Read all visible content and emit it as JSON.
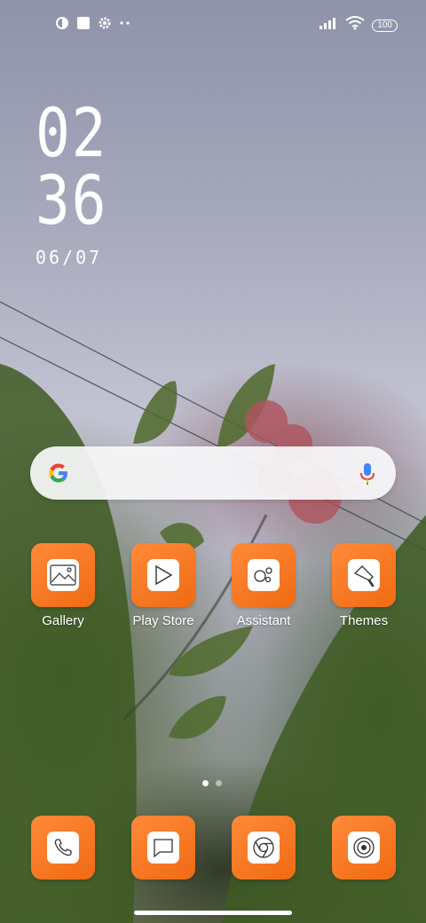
{
  "status_bar": {
    "battery_level": "100",
    "left_icons": [
      "shield-icon",
      "square-icon",
      "gear-icon",
      "more-dots-icon"
    ],
    "right_icons": [
      "signal-icon",
      "wifi-icon",
      "battery-icon"
    ]
  },
  "clock": {
    "hour": "02",
    "minute": "36",
    "date": "06/07"
  },
  "search_bar": {
    "icons": [
      "google-g-icon",
      "microphone-icon"
    ]
  },
  "apps": [
    {
      "label": "Gallery",
      "icon": "gallery-icon"
    },
    {
      "label": "Play Store",
      "icon": "play-store-icon"
    },
    {
      "label": "Assistant",
      "icon": "assistant-icon"
    },
    {
      "label": "Themes",
      "icon": "themes-icon"
    }
  ],
  "page_indicator": {
    "pages": 2,
    "current": 1
  },
  "dock": [
    {
      "icon": "phone-icon"
    },
    {
      "icon": "messages-icon"
    },
    {
      "icon": "chrome-icon"
    },
    {
      "icon": "camera-icon"
    }
  ],
  "colors": {
    "app_tile": "#f47a23",
    "search_bar": "#f8f8fa",
    "text": "#ffffff"
  }
}
